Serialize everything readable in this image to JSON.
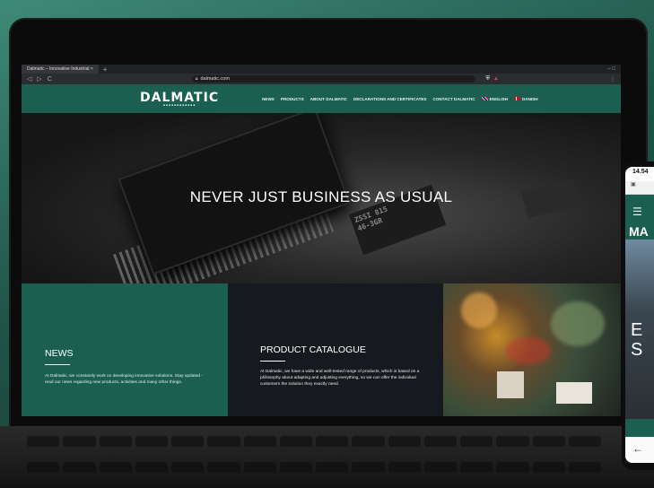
{
  "browser": {
    "tab_title": "Dalmatic – Innovative Industrial ×",
    "tab_close": "×",
    "new_tab": "+",
    "url": "dalmatic.com",
    "back": "◁",
    "forward": "▷",
    "reload": "C",
    "window_controls": "–   □"
  },
  "site": {
    "logo": "DALMATIC",
    "nav": [
      "NEWS",
      "PRODUCTS",
      "ABOUT DALMATIC",
      "DECLARATIONS AND CERTIFICATES",
      "CONTACT DALMATIC",
      "ENGLISH",
      "DANISH"
    ],
    "hero_title": "NEVER JUST BUSINESS AS USUAL",
    "chip_text": "ZSSI 815\n46-3GR",
    "news": {
      "title": "NEWS",
      "text": "At Dalmatic, we constantly work on developing innovative solutions. Stay updated - read our news regarding new products, activities and many other things."
    },
    "catalogue": {
      "title": "PRODUCT CATALOGUE",
      "text": "At Dalmatic, we have a wide and well-tested range of products, which is based on a philosophy about adapting and adjusting everything, so we can offer the individual customers the solution they exactly need."
    }
  },
  "phone": {
    "time": "14.54",
    "menu_icon": "☰",
    "logo": "MA",
    "hero_text": "E\nS",
    "back": "←"
  },
  "colors": {
    "brand_green": "#1b5f51",
    "dark_panel": "#161a1e"
  }
}
